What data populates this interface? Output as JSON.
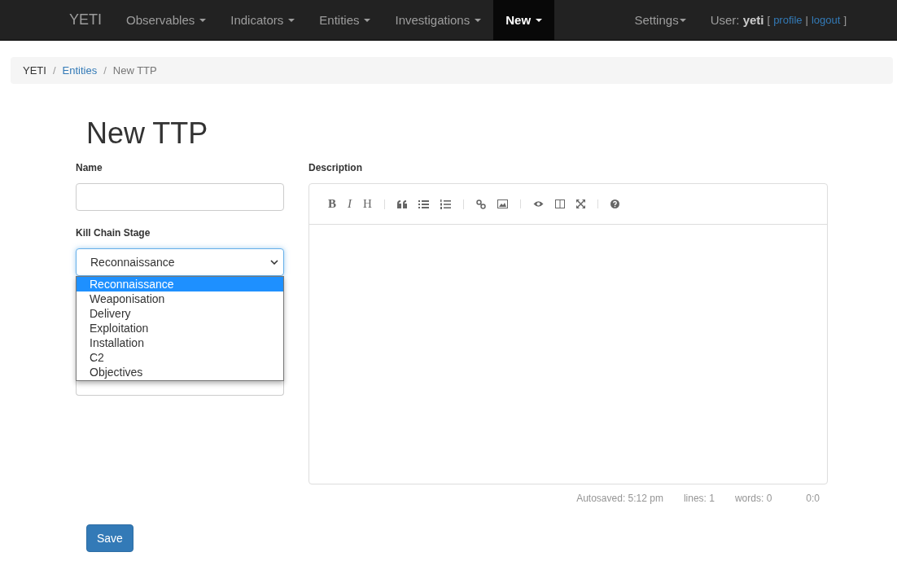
{
  "navbar": {
    "brand": "YETI",
    "items": [
      {
        "label": "Observables",
        "selected": false
      },
      {
        "label": "Indicators",
        "selected": false
      },
      {
        "label": "Entities",
        "selected": false
      },
      {
        "label": "Investigations",
        "selected": false
      },
      {
        "label": "New",
        "selected": true
      }
    ],
    "settings": "Settings",
    "user": {
      "prefix": "User:",
      "name": "yeti",
      "open": "[",
      "links": [
        "profile",
        "logout"
      ],
      "separator": "|",
      "close": "]"
    }
  },
  "breadcrumb_separator": "/",
  "breadcrumb": [
    {
      "label": "YETI",
      "kind": "text"
    },
    {
      "label": "Entities",
      "kind": "link"
    },
    {
      "label": "New TTP",
      "kind": "current"
    }
  ],
  "title": "New TTP",
  "form": {
    "name": {
      "label": "Name"
    },
    "kill_chain": {
      "label": "Kill Chain Stage",
      "value": "Reconnaissance",
      "expanded": true,
      "options": [
        {
          "label": "Reconnaissance",
          "selected": true
        },
        {
          "label": "Weaponisation",
          "selected": false
        },
        {
          "label": "Delivery",
          "selected": false
        },
        {
          "label": "Exploitation",
          "selected": false
        },
        {
          "label": "Installation",
          "selected": false
        },
        {
          "label": "C2",
          "selected": false
        },
        {
          "label": "Objectives",
          "selected": false
        }
      ]
    },
    "description": {
      "label": "Description",
      "toolbar": [
        [
          {
            "kind": "bold",
            "label": "B"
          },
          {
            "kind": "italic",
            "label": "I"
          },
          {
            "kind": "heading",
            "label": "H"
          }
        ],
        [
          {
            "kind": "quote"
          },
          {
            "kind": "bullets"
          },
          {
            "kind": "numbers"
          }
        ],
        [
          {
            "kind": "link"
          },
          {
            "kind": "image"
          }
        ],
        [
          {
            "kind": "eye"
          },
          {
            "kind": "columns"
          },
          {
            "kind": "expand"
          }
        ],
        [
          {
            "kind": "help"
          }
        ]
      ],
      "status": [
        "Autosaved: 5:12 pm",
        "lines: 1",
        "words: 0",
        "0:0"
      ]
    }
  },
  "save": "Save"
}
